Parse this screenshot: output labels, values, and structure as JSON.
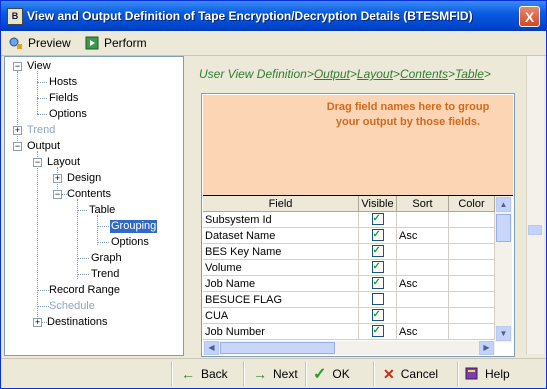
{
  "window": {
    "title": "View and Output Definition of Tape Encryption/Decryption Details (BTESMFID)",
    "close_label": "X"
  },
  "toolbar": {
    "preview_label": "Preview",
    "perform_label": "Perform"
  },
  "tree": {
    "view": "View",
    "hosts": "Hosts",
    "fields": "Fields",
    "options": "Options",
    "trend": "Trend",
    "output": "Output",
    "layout": "Layout",
    "design": "Design",
    "contents": "Contents",
    "table": "Table",
    "grouping": "Grouping",
    "table_options": "Options",
    "graph": "Graph",
    "trend2": "Trend",
    "record_range": "Record Range",
    "schedule": "Schedule",
    "destinations": "Destinations"
  },
  "breadcrumb": {
    "root": "User View Definition",
    "sep": ">",
    "output": "Output",
    "layout": "Layout",
    "contents": "Contents",
    "table": "Table",
    "tail": ">"
  },
  "group_area": {
    "hint": "Drag field names here to group your output by those fields."
  },
  "grid": {
    "columns": [
      "Field",
      "Visible",
      "Sort",
      "Color"
    ],
    "rows": [
      {
        "field": "Subsystem Id",
        "visible": true,
        "sort": "",
        "color": ""
      },
      {
        "field": "Dataset Name",
        "visible": true,
        "sort": "Asc",
        "color": ""
      },
      {
        "field": "BES Key Name",
        "visible": true,
        "sort": "",
        "color": ""
      },
      {
        "field": "Volume",
        "visible": true,
        "sort": "",
        "color": ""
      },
      {
        "field": "Job Name",
        "visible": true,
        "sort": "Asc",
        "color": ""
      },
      {
        "field": "BESUCE FLAG",
        "visible": false,
        "sort": "",
        "color": ""
      },
      {
        "field": "CUA",
        "visible": true,
        "sort": "",
        "color": ""
      },
      {
        "field": "Job Number",
        "visible": true,
        "sort": "Asc",
        "color": ""
      }
    ]
  },
  "buttons": {
    "back": "Back",
    "next": "Next",
    "ok": "OK",
    "cancel": "Cancel",
    "help": "Help"
  }
}
